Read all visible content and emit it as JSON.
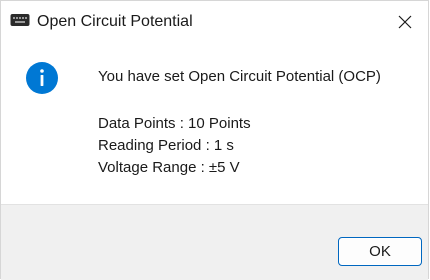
{
  "window": {
    "title": "Open Circuit Potential",
    "app_icon": "keyboard-like-app-icon",
    "close_icon": "close-icon"
  },
  "message": {
    "icon": "info-icon",
    "heading": "You have set Open Circuit Potential (OCP)",
    "details": [
      "Data Points : 10 Points",
      "Reading Period : 1 s",
      "Voltage Range : ±5 V"
    ]
  },
  "buttons": {
    "ok_label": "OK"
  },
  "colors": {
    "info_icon": "#0078d4",
    "ok_border": "#0067c0",
    "footer_bg": "#f0f0f0"
  }
}
